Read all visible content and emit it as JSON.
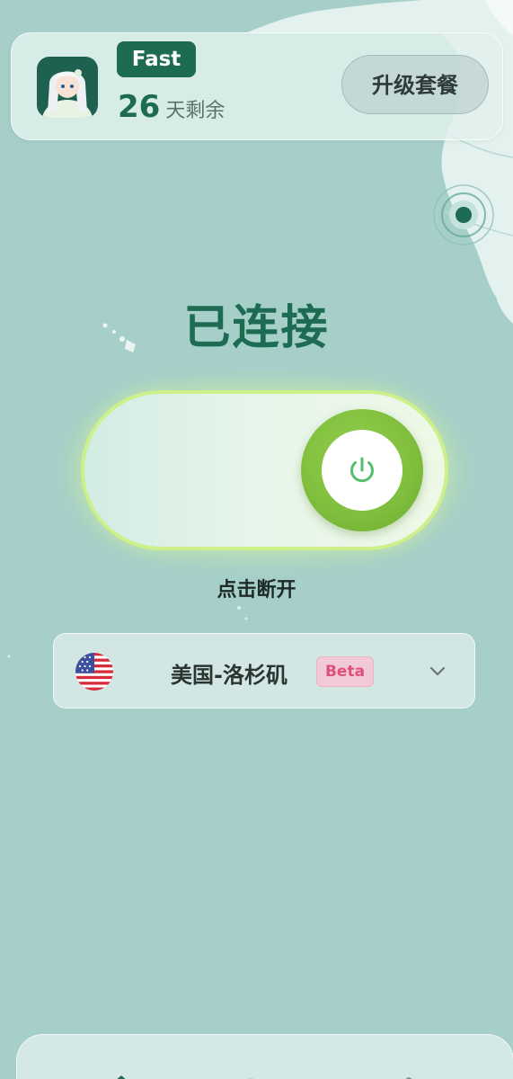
{
  "header": {
    "plan_badge": "Fast",
    "days_remaining": "26",
    "days_label": "天剩余",
    "upgrade_label": "升级套餐"
  },
  "connection": {
    "status": "已连接",
    "hint": "点击断开",
    "connected": true
  },
  "server": {
    "name": "美国-洛杉矶",
    "badge": "Beta",
    "flag": "us-flag-icon"
  },
  "colors": {
    "primary": "#1c6b52",
    "toggle_knob": "#7fbe3c",
    "toggle_border": "#cdf08a",
    "background": "#a6cfc9",
    "beta_text": "#e0507c",
    "beta_bg": "#f2c9d6"
  },
  "nav": {
    "icons": [
      "home-icon",
      "shop-icon",
      "settings-icon"
    ]
  }
}
